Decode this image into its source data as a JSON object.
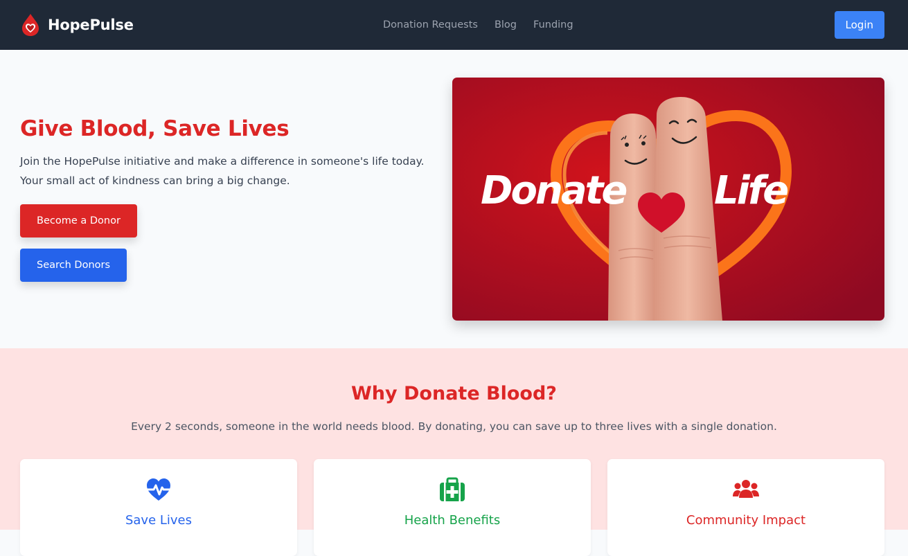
{
  "brand": {
    "name": "HopePulse",
    "logo_icon": "blood-drop-heart-icon"
  },
  "nav": {
    "links": [
      "Donation Requests",
      "Blog",
      "Funding"
    ],
    "login_label": "Login"
  },
  "hero": {
    "title": "Give Blood, Save Lives",
    "text": "Join the HopePulse initiative and make a difference in someone's life today. Your small act of kindness can bring a big change.",
    "donor_button": "Become a Donor",
    "search_button": "Search Donors",
    "image_words": [
      "Donate",
      "Life"
    ]
  },
  "why": {
    "title": "Why Donate Blood?",
    "text": "Every 2 seconds, someone in the world needs blood. By donating, you can save up to three lives with a single donation.",
    "cards": [
      {
        "title": "Save Lives",
        "icon": "heartbeat-icon",
        "color": "#2563eb"
      },
      {
        "title": "Health Benefits",
        "icon": "medical-kit-icon",
        "color": "#16a34a"
      },
      {
        "title": "Community Impact",
        "icon": "users-icon",
        "color": "#dc2626"
      }
    ]
  },
  "colors": {
    "nav_bg": "#1f2937",
    "primary_red": "#dc2626",
    "primary_blue": "#2563eb",
    "login_blue": "#3b82f6",
    "why_bg": "#fee2e2"
  }
}
